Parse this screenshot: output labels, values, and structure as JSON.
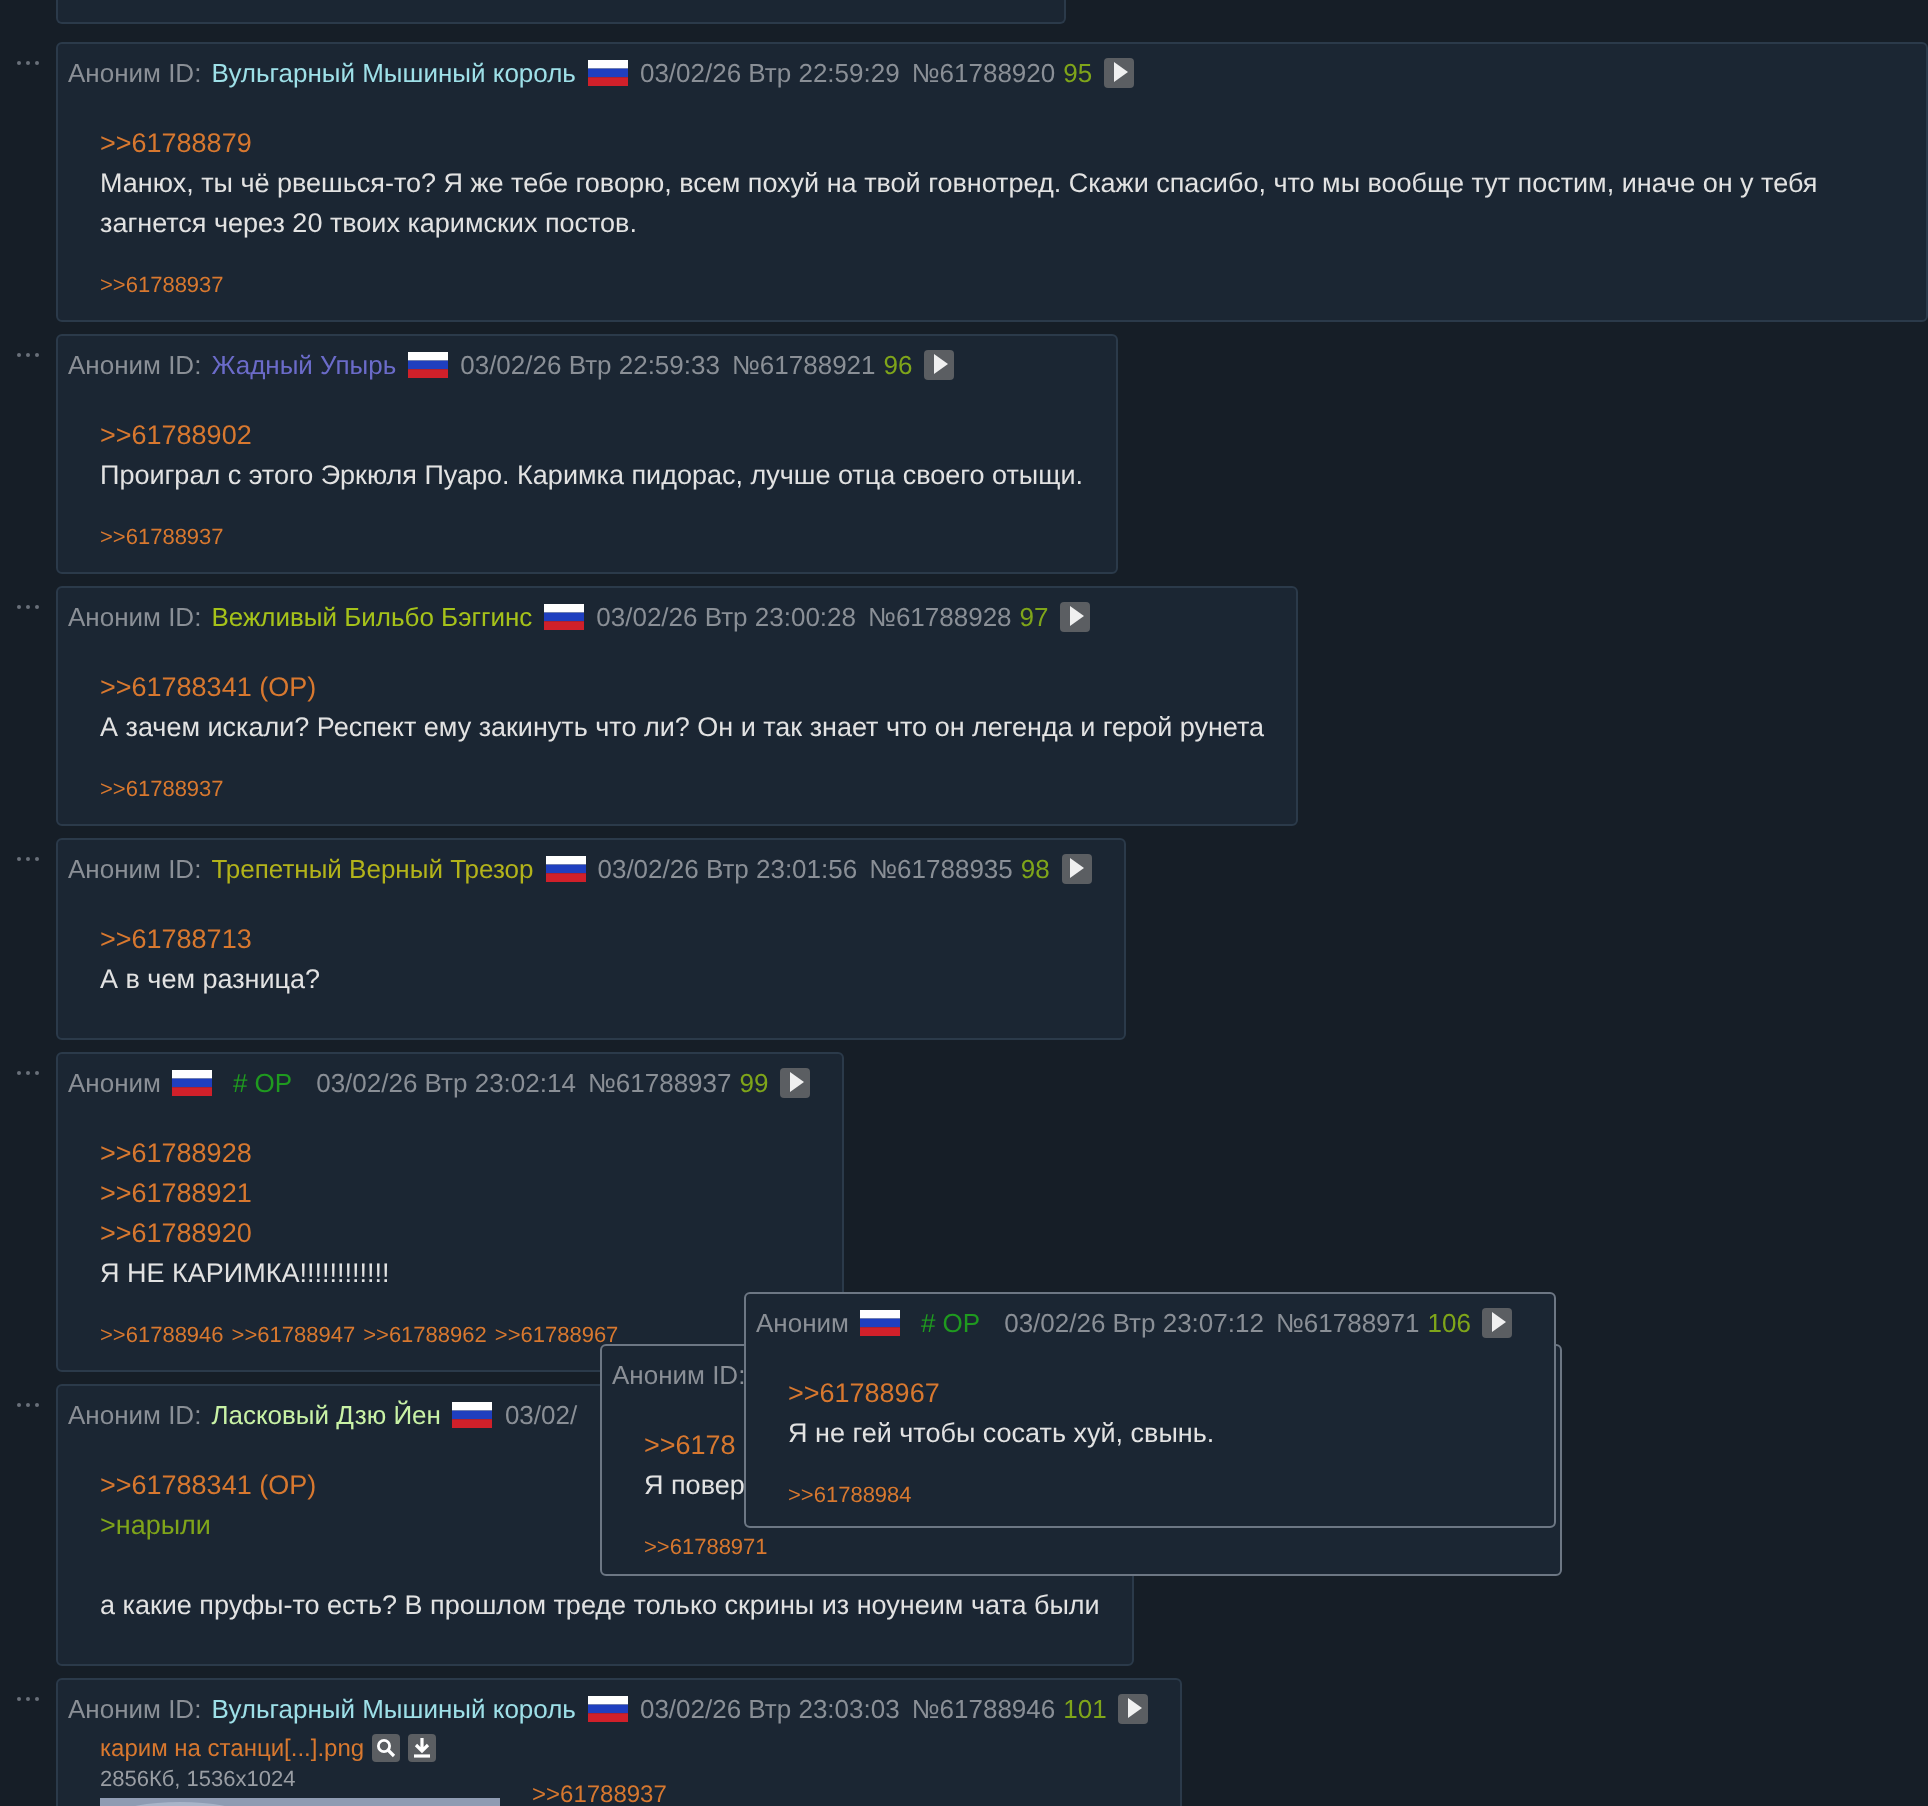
{
  "posts": [
    {
      "author": "Аноним",
      "id_label": "ID:",
      "name": "Вульгарный Мышиный король",
      "color": "#9ee0e8",
      "date": "03/02/26 Втр 22:59:29",
      "number": "№61788920",
      "count": "95",
      "lines": [
        {
          "kind": "link",
          "text": ">>61788879"
        },
        {
          "kind": "text",
          "text": "Манюх, ты чё рвешься-то? Я же тебе говорю, всем похуй на твой говнотред. Скажи спасибо, что мы вообще тут постим, иначе он у тебя загнется через 20 твоих каримских постов."
        }
      ],
      "replies": [
        ">>61788937"
      ]
    },
    {
      "author": "Аноним",
      "id_label": "ID:",
      "name": "Жадный Упырь",
      "color": "#6b6bc9",
      "date": "03/02/26 Втр 22:59:33",
      "number": "№61788921",
      "count": "96",
      "lines": [
        {
          "kind": "link",
          "text": ">>61788902"
        },
        {
          "kind": "text",
          "text": "Проиграл с этого Эркюля Пуаро. Каримка пидорас, лучше отца своего отыщи."
        }
      ],
      "replies": [
        ">>61788937"
      ]
    },
    {
      "author": "Аноним",
      "id_label": "ID:",
      "name": "Вежливый Бильбо Бэггинс",
      "color": "#a6c21a",
      "date": "03/02/26 Втр 23:00:28",
      "number": "№61788928",
      "count": "97",
      "lines": [
        {
          "kind": "link",
          "text": ">>61788341 (OP)"
        },
        {
          "kind": "text",
          "text": "А зачем искали? Респект ему закинуть что ли? Он и так знает что он легенда и герой рунета"
        }
      ],
      "replies": [
        ">>61788937"
      ]
    },
    {
      "author": "Аноним",
      "id_label": "ID:",
      "name": "Трепетный Верный Трезор",
      "color": "#b3b31a",
      "date": "03/02/26 Втр 23:01:56",
      "number": "№61788935",
      "count": "98",
      "lines": [
        {
          "kind": "link",
          "text": ">>61788713"
        },
        {
          "kind": "text",
          "text": "А в чем разница?"
        }
      ]
    },
    {
      "author": "Аноним",
      "op_tag": "# OP",
      "date": "03/02/26 Втр 23:02:14",
      "number": "№61788937",
      "count": "99",
      "lines": [
        {
          "kind": "link",
          "text": ">>61788928"
        },
        {
          "kind": "link",
          "text": ">>61788921"
        },
        {
          "kind": "link",
          "text": ">>61788920"
        },
        {
          "kind": "text",
          "text": "Я НЕ КАРИМКА!!!!!!!!!!!!"
        }
      ],
      "replies": [
        ">>61788946",
        ">>61788947",
        ">>61788962",
        ">>61788967"
      ]
    },
    {
      "author": "Аноним",
      "id_label": "ID:",
      "name": "Ласковый Дзю Йен",
      "color": "#c9f2a6",
      "date": "03/02/",
      "lines": [
        {
          "kind": "link",
          "text": ">>61788341 (OP)"
        },
        {
          "kind": "quote",
          "text": ">нарыли"
        },
        {
          "kind": "gap"
        },
        {
          "kind": "text",
          "text": "а какие пруфы-то есть? В прошлом треде только скрины из ноунеим чата были"
        }
      ]
    },
    {
      "author": "Аноним",
      "id_label": "ID:",
      "name": "Вульгарный Мышиный король",
      "color": "#9ee0e8",
      "date": "03/02/26 Втр 23:03:03",
      "number": "№61788946",
      "count": "101",
      "file": {
        "name": "карим на станци[...].png",
        "info": "2856Кб, 1536x1024"
      },
      "lines": [
        {
          "kind": "link",
          "text": ">>61788937"
        }
      ]
    }
  ],
  "popups": [
    {
      "author": "Аноним",
      "id_label": "ID:",
      "lines": [
        {
          "kind": "link",
          "text": ">>6178"
        },
        {
          "kind": "text",
          "text": "Я повер"
        }
      ],
      "replies": [
        ">>61788971"
      ]
    },
    {
      "author": "Аноним",
      "op_tag": "# OP",
      "date": "03/02/26 Втр 23:07:12",
      "number": "№61788971",
      "count": "106",
      "lines": [
        {
          "kind": "link",
          "text": ">>61788967"
        },
        {
          "kind": "text",
          "text": "Я не гей чтобы сосать хуй, свынь."
        }
      ],
      "replies": [
        ">>61788984"
      ]
    }
  ]
}
